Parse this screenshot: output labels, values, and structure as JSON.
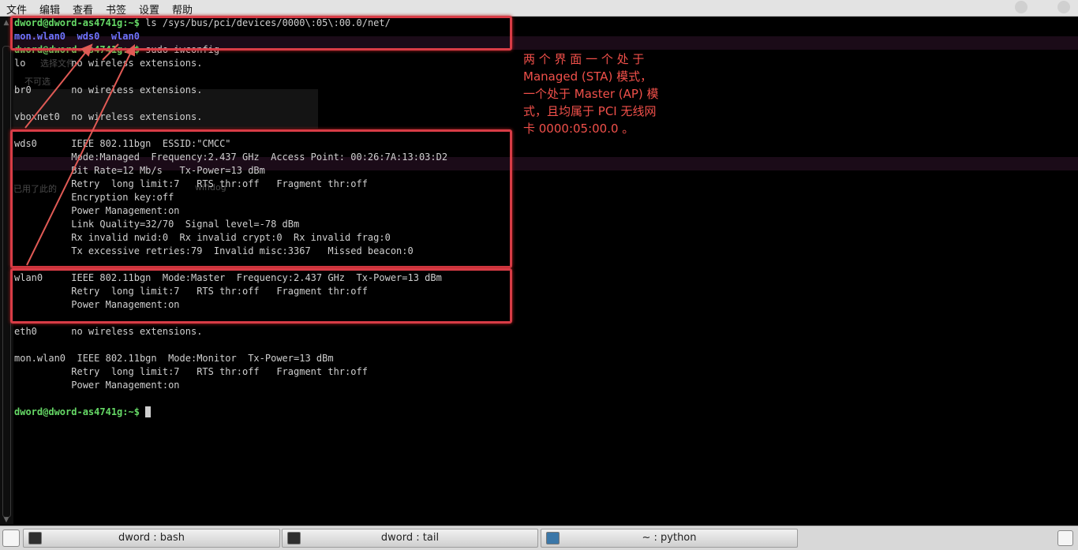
{
  "menu": {
    "items": [
      "文件",
      "编辑",
      "查看",
      "书签",
      "设置",
      "帮助"
    ]
  },
  "terminal": {
    "prompt": "dword@dword-as4741g:~$",
    "cmd1": " ls /sys/bus/pci/devices/0000\\:05\\:00.0/net/",
    "ls_output": "mon.wlan0  wds0  wlan0",
    "cmd2": " sudo iwconfig",
    "lines": [
      "lo        no wireless extensions.",
      "",
      "br0       no wireless extensions.",
      "",
      "vboxnet0  no wireless extensions.",
      "",
      "wds0      IEEE 802.11bgn  ESSID:\"CMCC\"",
      "          Mode:Managed  Frequency:2.437 GHz  Access Point: 00:26:7A:13:03:D2",
      "          Bit Rate=12 Mb/s   Tx-Power=13 dBm",
      "          Retry  long limit:7   RTS thr:off   Fragment thr:off",
      "          Encryption key:off",
      "          Power Management:on",
      "          Link Quality=32/70  Signal level=-78 dBm",
      "          Rx invalid nwid:0  Rx invalid crypt:0  Rx invalid frag:0",
      "          Tx excessive retries:79  Invalid misc:3367   Missed beacon:0",
      "",
      "wlan0     IEEE 802.11bgn  Mode:Master  Frequency:2.437 GHz  Tx-Power=13 dBm",
      "          Retry  long limit:7   RTS thr:off   Fragment thr:off",
      "          Power Management:on",
      "",
      "eth0      no wireless extensions.",
      "",
      "mon.wlan0  IEEE 802.11bgn  Mode:Monitor  Tx-Power=13 dBm",
      "          Retry  long limit:7   RTS thr:off   Fragment thr:off",
      "          Power Management:on",
      ""
    ],
    "final_prompt": "dword@dword-as4741g:~$"
  },
  "annotation": {
    "lines": [
      "两 个 界 面 一 个 处 于",
      "Managed (STA) 模式，",
      "一个处于 Master (AP) 模",
      "式，且均属于 PCI 无线网",
      "卡 0000:05:00.0 。"
    ],
    "color": "#f0504a"
  },
  "ghost_text": {
    "a": "选择文件",
    "b": "不可选",
    "c": "已用了此的",
    "d": "wifidog"
  },
  "taskbar": {
    "tasks": [
      {
        "label": "dword : bash",
        "icon": "terminal-icon"
      },
      {
        "label": "dword : tail",
        "icon": "terminal-icon"
      },
      {
        "label": "~ : python",
        "icon": "python-icon"
      }
    ]
  }
}
